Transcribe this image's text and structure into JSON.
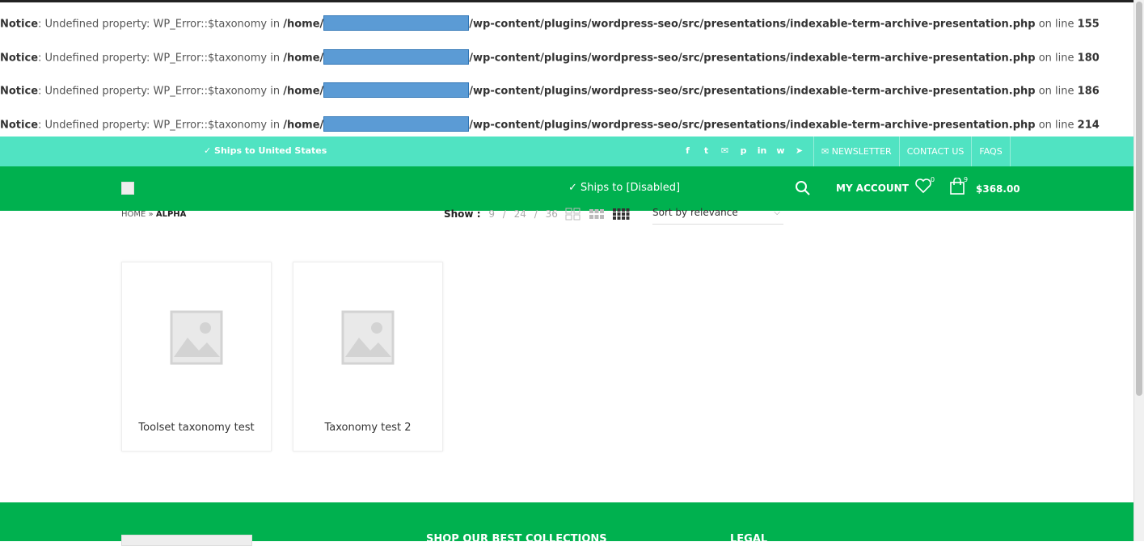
{
  "notices": [
    {
      "label": "Notice",
      "message": ": Undefined property: WP_Error::$taxonomy in ",
      "path_start": "/home/",
      "path_end": "/wp-content/plugins/wordpress-seo/src/presentations/indexable-term-archive-presentation.php",
      "on_line": " on line ",
      "line": "155"
    },
    {
      "label": "Notice",
      "message": ": Undefined property: WP_Error::$taxonomy in ",
      "path_start": "/home/",
      "path_end": "/wp-content/plugins/wordpress-seo/src/presentations/indexable-term-archive-presentation.php",
      "on_line": " on line ",
      "line": "180"
    },
    {
      "label": "Notice",
      "message": ": Undefined property: WP_Error::$taxonomy in ",
      "path_start": "/home/",
      "path_end": "/wp-content/plugins/wordpress-seo/src/presentations/indexable-term-archive-presentation.php",
      "on_line": " on line ",
      "line": "186"
    },
    {
      "label": "Notice",
      "message": ": Undefined property: WP_Error::$taxonomy in ",
      "path_start": "/home/",
      "path_end": "/wp-content/plugins/wordpress-seo/src/presentations/indexable-term-archive-presentation.php",
      "on_line": " on line ",
      "line": "214"
    }
  ],
  "topbar": {
    "ships": "✓ Ships to United States",
    "socials": [
      "f",
      "t",
      "✉",
      "p",
      "in",
      "w",
      "➤"
    ],
    "nav": [
      "NEWSLETTER",
      "CONTACT US",
      "FAQS"
    ]
  },
  "header": {
    "ships": "✓ Ships to [Disabled]",
    "my_account": "MY ACCOUNT",
    "wishlist_count": "0",
    "cart_count": "9",
    "cart_total": "$368.00"
  },
  "breadcrumb": {
    "home": "HOME",
    "sep": " » ",
    "current": "ALPHA"
  },
  "toolbar": {
    "show_label": "Show :",
    "show_options": [
      "9",
      "/",
      "24",
      "/",
      "36"
    ],
    "sort_value": "Sort by relevance"
  },
  "products": [
    {
      "title": "Toolset taxonomy test"
    },
    {
      "title": "Taxonomy test 2"
    }
  ],
  "footer": {
    "col1": "SHOP OUR BEST COLLECTIONS",
    "col2": "LEGAL"
  },
  "colors": {
    "topbar": "#50e3c2",
    "header": "#00b14f",
    "redact": "#5b9bd5"
  }
}
